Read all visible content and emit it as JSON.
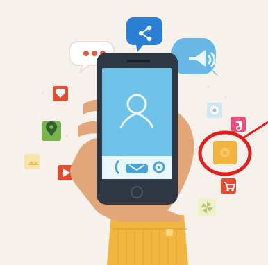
{
  "illustration": {
    "background_color": "#f6f1ea",
    "accent_colors": {
      "share": "#2a7fd4",
      "speech_left": "#ffffff",
      "speech_left_dots": "#e8573b",
      "speech_right": "#67b8e5",
      "phone_body": "#2f3742",
      "phone_screen": "#6fc2e7",
      "hand": "#e2a679",
      "sleeve": "#f2b53f",
      "annotation_red": "#e31c1c"
    },
    "icons": [
      "share-icon",
      "chat-bubble-icon",
      "megaphone-icon",
      "heart-icon",
      "location-pin-icon",
      "play-icon",
      "image-icon",
      "music-note-icon",
      "camera-icon",
      "shopping-cart-icon",
      "user-profile-icon",
      "phone-call-icon",
      "settings-gear-icon"
    ]
  }
}
